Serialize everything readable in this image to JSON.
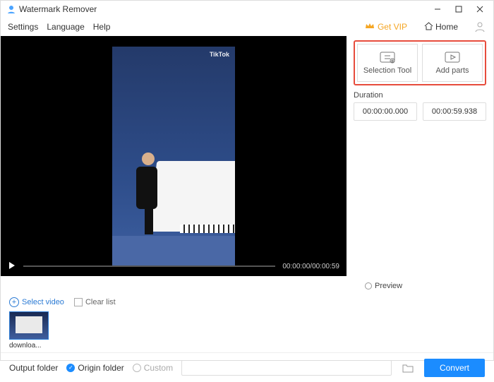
{
  "titlebar": {
    "app_name": "Watermark Remover"
  },
  "menubar": {
    "items": [
      "Settings",
      "Language",
      "Help"
    ],
    "vip_label": "Get VIP",
    "home_label": "Home"
  },
  "video": {
    "watermark_text": "TikTok",
    "timecode": "00:00:00/00:00:59"
  },
  "side": {
    "selection_tool": "Selection Tool",
    "add_parts": "Add parts",
    "duration_label": "Duration",
    "start_time": "00:00:00.000",
    "end_time": "00:00:59.938"
  },
  "preview_label": "Preview",
  "file_row": {
    "select_video": "Select video",
    "clear_list": "Clear list"
  },
  "thumb": {
    "filename": "downloa..."
  },
  "footer": {
    "output_label": "Output folder",
    "origin_label": "Origin folder",
    "custom_label": "Custom",
    "convert_label": "Convert"
  }
}
